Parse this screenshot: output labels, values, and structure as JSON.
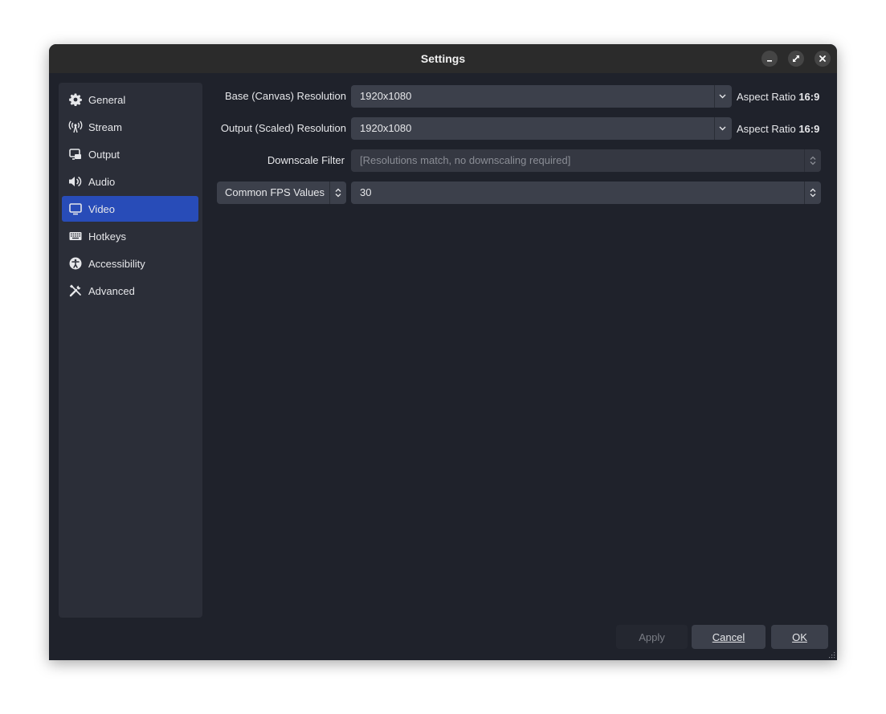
{
  "window": {
    "title": "Settings"
  },
  "sidebar": {
    "items": [
      {
        "label": "General",
        "icon": "gear-icon",
        "active": false
      },
      {
        "label": "Stream",
        "icon": "broadcast-icon",
        "active": false
      },
      {
        "label": "Output",
        "icon": "output-icon",
        "active": false
      },
      {
        "label": "Audio",
        "icon": "speaker-icon",
        "active": false
      },
      {
        "label": "Video",
        "icon": "monitor-icon",
        "active": true
      },
      {
        "label": "Hotkeys",
        "icon": "keyboard-icon",
        "active": false
      },
      {
        "label": "Accessibility",
        "icon": "accessibility-icon",
        "active": false
      },
      {
        "label": "Advanced",
        "icon": "tools-icon",
        "active": false
      }
    ]
  },
  "video": {
    "base_resolution": {
      "label": "Base (Canvas) Resolution",
      "value": "1920x1080",
      "aspect_prefix": "Aspect Ratio",
      "aspect_value": "16:9"
    },
    "output_resolution": {
      "label": "Output (Scaled) Resolution",
      "value": "1920x1080",
      "aspect_prefix": "Aspect Ratio",
      "aspect_value": "16:9"
    },
    "downscale_filter": {
      "label": "Downscale Filter",
      "value": "[Resolutions match, no downscaling required]"
    },
    "fps": {
      "type_label": "Common FPS Values",
      "value": "30"
    }
  },
  "buttons": {
    "apply": "Apply",
    "cancel": "Cancel",
    "ok": "OK"
  },
  "colors": {
    "accent": "#284cb8",
    "background": "#1f222b",
    "panel": "#2b2e38"
  }
}
